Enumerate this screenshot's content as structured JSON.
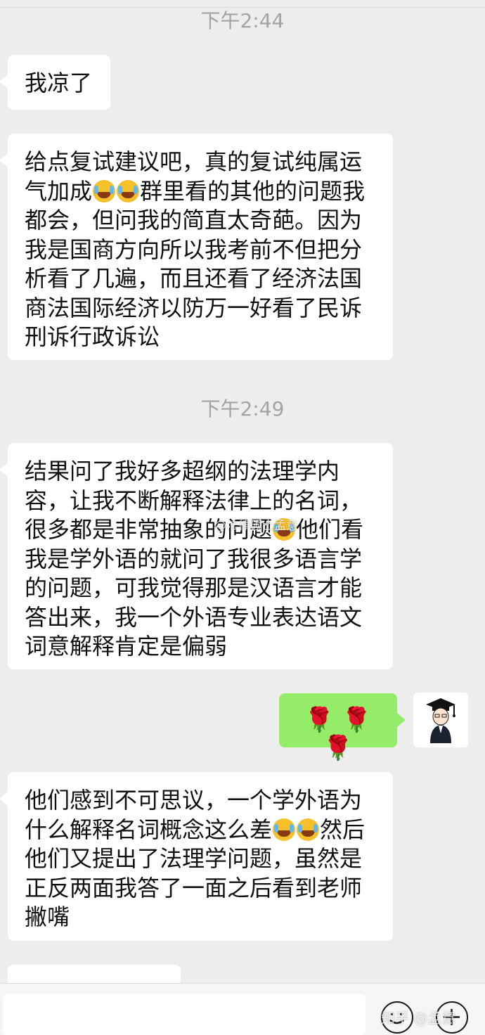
{
  "timestamps": [
    "下午2:44",
    "下午2:49"
  ],
  "messages": {
    "m1": "我凉了",
    "m2": {
      "p1": "给点复试建议吧，真的复试纯属运气加成",
      "p2": "群里看的其他的问题我都会，但问我的简直太奇葩。因为我是国商方向所以我考前不但把分析看了几遍，而且还看了经济法国商法国际经济以防万一好看了民诉刑诉行政诉讼"
    },
    "m3": {
      "p1": "结果问了我好多超纲的法理学内容，让我不断解释法律上的名词，很多都是非常抽象的问题",
      "p2": "他们看我是学外语的就问了我很多语言学的问题，可我觉得那是汉语言才能答出来，我一个外语专业表达语文词意解释肯定是偏弱"
    },
    "m4": "🌹 🌹 🌹",
    "m5": {
      "p1": "他们感到不可思议，一个学外语为什么解释名词概念这么差",
      "p2": "然后他们又提出了法理学问题，虽然是正反两面我答了一面之后看到老师撇嘴"
    }
  },
  "emoji": {
    "name": "crying-laughing-emoji"
  },
  "watermarks": {
    "inline": "@法律硕士孟意",
    "corner": "知乎 @孟意"
  },
  "colors": {
    "background": "#ededed",
    "incoming_bubble": "#ffffff",
    "outgoing_bubble": "#95ec69",
    "timestamp": "#a3a3a3"
  }
}
